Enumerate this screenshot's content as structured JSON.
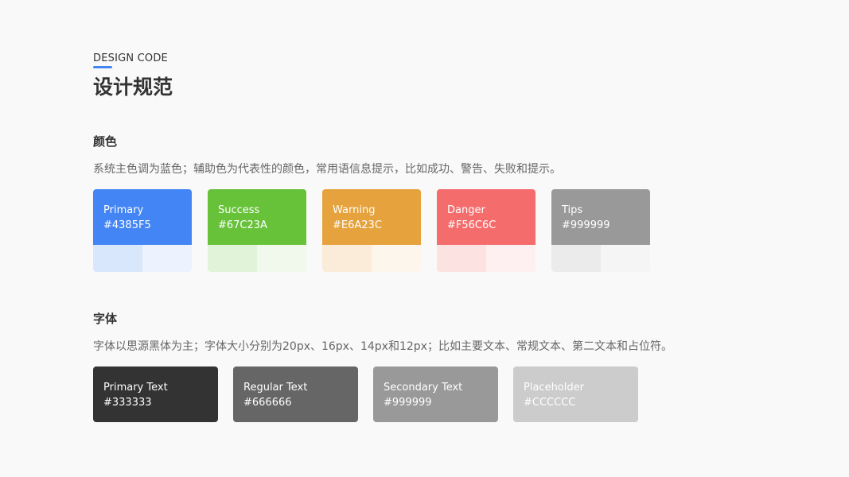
{
  "header": {
    "eyebrow": "DESIGN CODE",
    "title": "设计规范",
    "accent": "#4385F5"
  },
  "colors_section": {
    "title": "颜色",
    "description": "系统主色调为蓝色；辅助色为代表性的颜色，常用语信息提示，比如成功、警告、失败和提示。",
    "cards": [
      {
        "name": "Primary",
        "hex": "#4385F5",
        "color": "#4385F5",
        "shade1": "#D9E7FD",
        "shade2": "#ECF3FE"
      },
      {
        "name": "Success",
        "hex": "#67C23A",
        "color": "#67C23A",
        "shade1": "#E1F3D8",
        "shade2": "#F0F9EB"
      },
      {
        "name": "Warning",
        "hex": "#E6A23C",
        "color": "#E6A23C",
        "shade1": "#FAECD8",
        "shade2": "#FDF6EC"
      },
      {
        "name": "Danger",
        "hex": "#F56C6C",
        "color": "#F56C6C",
        "shade1": "#FDE2E2",
        "shade2": "#FEF0F0"
      },
      {
        "name": "Tips",
        "hex": "#999999",
        "color": "#999999",
        "shade1": "#EBEBEB",
        "shade2": "#F5F5F5"
      }
    ]
  },
  "fonts_section": {
    "title": "字体",
    "description": "字体以思源黑体为主；字体大小分别为20px、16px、14px和12px；比如主要文本、常规文本、第二文本和占位符。",
    "cards": [
      {
        "name": "Primary Text",
        "hex": "#333333",
        "color": "#333333"
      },
      {
        "name": "Regular Text",
        "hex": "#666666",
        "color": "#666666"
      },
      {
        "name": "Secondary Text",
        "hex": "#999999",
        "color": "#999999"
      },
      {
        "name": "Placeholder",
        "hex": "#CCCCCC",
        "color": "#CCCCCC"
      }
    ]
  }
}
